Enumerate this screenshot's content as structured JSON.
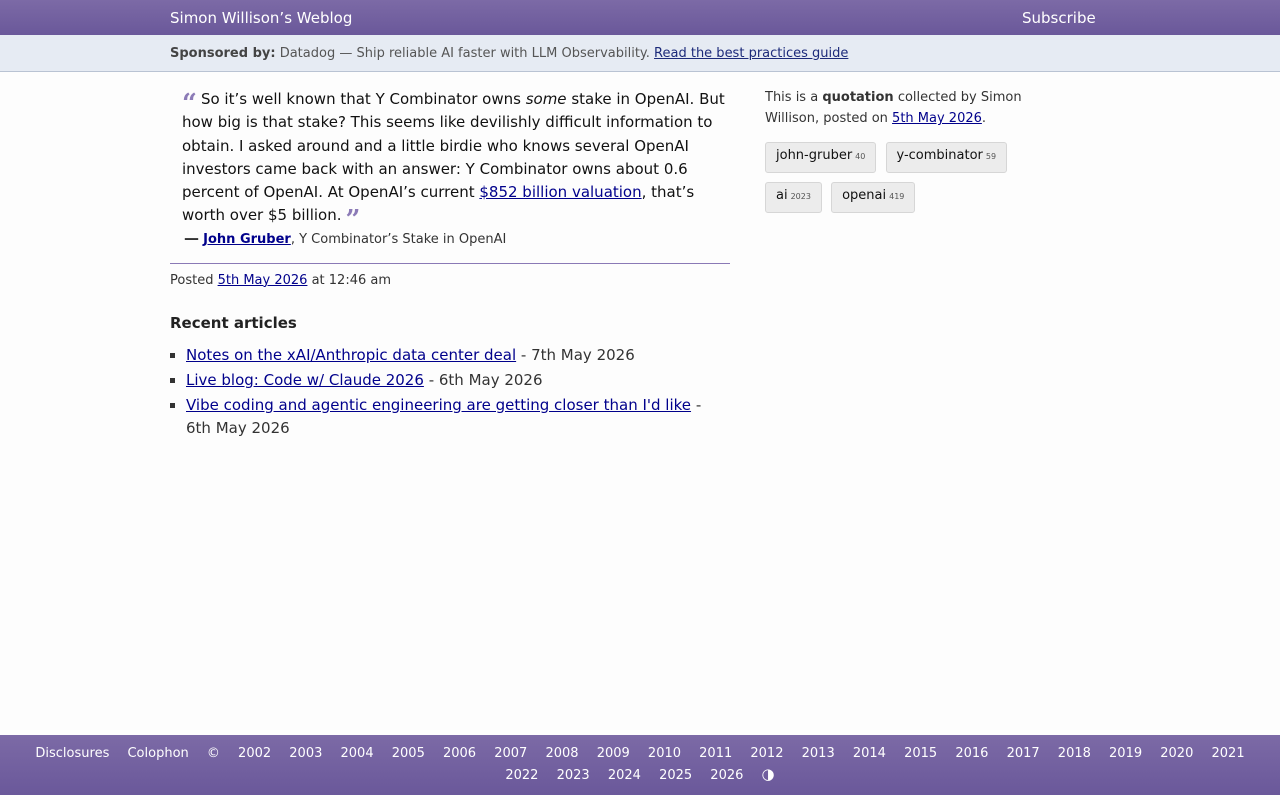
{
  "header": {
    "site_title": "Simon Willison’s Weblog",
    "subscribe": "Subscribe"
  },
  "sponsor": {
    "label": "Sponsored by:",
    "text": "Datadog — Ship reliable AI faster with LLM Observability.",
    "link": "Read the best practices guide"
  },
  "quote": {
    "part1": "So it’s well known that Y Combinator owns ",
    "emphasis": "some",
    "part2": " stake in OpenAI. But how big is that stake? This seems like devilishly difficult information to obtain. I asked around and a little birdie who knows several OpenAI investors came back with an answer: Y Combinator owns about 0.6 percent of OpenAI. At OpenAI’s current ",
    "link": "$852 billion valuation",
    "part3": ", that’s worth over $5 billion.",
    "open_mark": "“",
    "close_mark": "”"
  },
  "citation": {
    "dash": "—",
    "author": "John Gruber",
    "separator": ",",
    "source": "Y Combinator’s Stake in OpenAI"
  },
  "posted": {
    "prefix": "Posted",
    "date": "5th May 2026",
    "time": "at 12:46 am"
  },
  "recent": {
    "heading": "Recent articles",
    "items": [
      {
        "title": "Notes on the xAI/Anthropic data center deal",
        "date": "- 7th May 2026"
      },
      {
        "title": "Live blog: Code w/ Claude 2026",
        "date": "- 6th May 2026"
      },
      {
        "title": "Vibe coding and agentic engineering are getting closer than I'd like",
        "date": "- 6th May 2026"
      }
    ]
  },
  "sidebar": {
    "intro_prefix": "This is a",
    "intro_type": "quotation",
    "intro_mid": "collected by Simon Willison, posted on",
    "intro_date": "5th May 2026",
    "intro_end": ".",
    "tags": [
      {
        "name": "john-gruber",
        "count": "40"
      },
      {
        "name": "y-combinator",
        "count": "59"
      },
      {
        "name": "ai",
        "count": "2023"
      },
      {
        "name": "openai",
        "count": "419"
      }
    ]
  },
  "footer": {
    "disclosures": "Disclosures",
    "colophon": "Colophon",
    "copyright": "©",
    "years": [
      "2002",
      "2003",
      "2004",
      "2005",
      "2006",
      "2007",
      "2008",
      "2009",
      "2010",
      "2011",
      "2012",
      "2013",
      "2014",
      "2015",
      "2016",
      "2017",
      "2018",
      "2019",
      "2020",
      "2021",
      "2022",
      "2023",
      "2024",
      "2025",
      "2026"
    ],
    "theme_toggle": "◑"
  },
  "colors": {
    "masthead": "#7c6aa6",
    "link": "#00008b",
    "sponsor_bg": "#e6ebf3"
  }
}
